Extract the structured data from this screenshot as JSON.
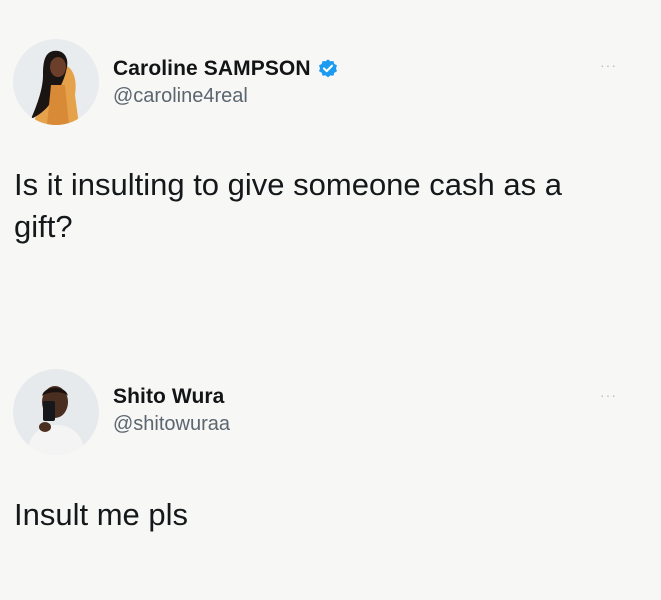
{
  "tweets": [
    {
      "display_name": "Caroline SAMPSON",
      "handle": "@caroline4real",
      "verified": true,
      "more_glyph": "···",
      "text": "Is it insulting to give someone cash as a gift?",
      "avatar_icon": "woman-portrait-avatar"
    },
    {
      "display_name": "Shito Wura",
      "handle": "@shitowuraa",
      "verified": false,
      "more_glyph": "···",
      "text": "Insult me pls",
      "avatar_icon": "man-selfie-avatar"
    }
  ],
  "colors": {
    "background": "#f7f7f5",
    "verified_badge": "#1d9bf0",
    "handle": "#5b6670"
  }
}
